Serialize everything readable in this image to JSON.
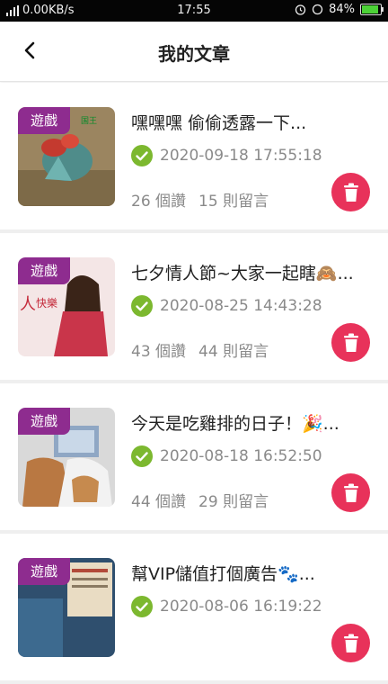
{
  "status_bar": {
    "network": "0.00KB/s",
    "time": "17:55",
    "battery": "84%",
    "battery_level": 0.84
  },
  "header": {
    "title": "我的文章",
    "back_icon": "chevron-left-icon"
  },
  "articles": [
    {
      "category": "遊戲",
      "title": "嘿嘿嘿 偷偷透露一下...",
      "date": "2020-09-18 17:55:18",
      "likes": "26 個讚",
      "comments": "15 則留言"
    },
    {
      "category": "遊戲",
      "title": "七夕情人節~大家一起瞎🙈...",
      "date": "2020-08-25 14:43:28",
      "likes": "43 個讚",
      "comments": "44 則留言"
    },
    {
      "category": "遊戲",
      "title": "今天是吃雞排的日子！🎉...",
      "date": "2020-08-18 16:52:50",
      "likes": "44 個讚",
      "comments": "29 則留言"
    },
    {
      "category": "遊戲",
      "title": "幫VIP儲值打個廣告🐾...",
      "date": "2020-08-06 16:19:22",
      "likes": "",
      "comments": ""
    }
  ],
  "colors": {
    "badge": "#8e2c8f",
    "delete": "#e8325a",
    "check": "#7cb82f"
  }
}
